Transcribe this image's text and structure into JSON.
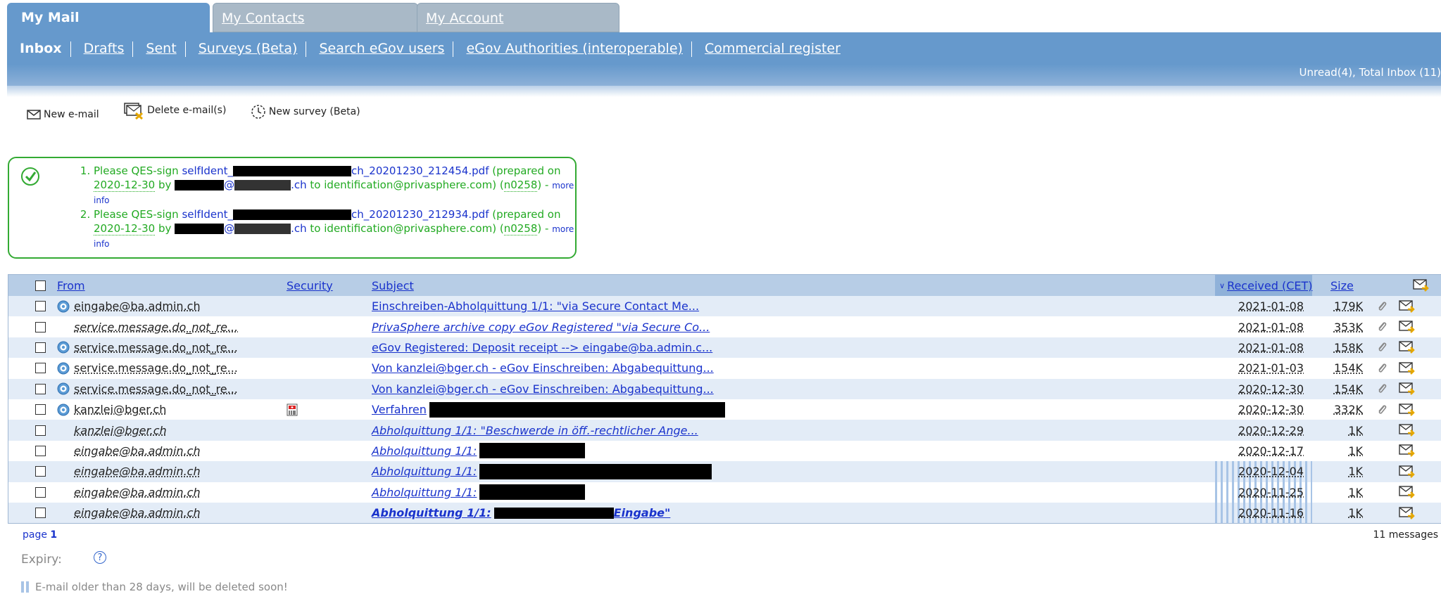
{
  "tabs": [
    {
      "label": "My Mail",
      "active": true
    },
    {
      "label": "My Contacts",
      "active": false
    },
    {
      "label": "My Account",
      "active": false
    }
  ],
  "subnav": {
    "items": [
      "Inbox",
      "Drafts",
      "Sent",
      "Surveys (Beta)",
      "Search eGov users",
      "eGov Authorities (interoperable)",
      "Commercial register"
    ],
    "current": "Inbox",
    "unread_status": "Unread(4), Total Inbox (11)"
  },
  "toolbar": {
    "new_email": "New e-mail",
    "delete_emails": "Delete e-mail(s)",
    "new_survey": "New survey (Beta)"
  },
  "notice": {
    "items": [
      {
        "prefix": "Please QES-sign ",
        "link_start": "selfIdent_",
        "link_end": "ch_20201230_212454.pdf",
        "prepared": " (prepared on ",
        "date": "2020-12-30",
        "by": " by ",
        "email_suffix": ".ch",
        "to": " to identification@privasphere.com) (",
        "code": "n0258",
        "after_code": ") - ",
        "more_info": "more info"
      },
      {
        "prefix": "Please QES-sign ",
        "link_start": "selfIdent_",
        "link_end": "ch_20201230_212934.pdf",
        "prepared": " (prepared on ",
        "date": "2020-12-30",
        "by": " by ",
        "email_suffix": ".ch",
        "to": " to identification@privasphere.com) (",
        "code": "n0258",
        "after_code": ") - ",
        "more_info": "more info"
      }
    ]
  },
  "table": {
    "headers": {
      "from": "From",
      "security": "Security",
      "subject": "Subject",
      "received": "Received (CET)",
      "size": "Size"
    },
    "rows": [
      {
        "from": "eingabe@ba.admin.ch",
        "subject": "Einschreiben-Abholquittung 1/1: \"via Secure Contact Me...",
        "date": "2021-01-08",
        "size": "179K",
        "secure_icon": true,
        "attachment": true,
        "italic": false
      },
      {
        "from": "service.message.do_not_re...",
        "subject": "PrivaSphere archive copy eGov Registered \"via Secure Co...",
        "date": "2021-01-08",
        "size": "353K",
        "secure_icon": false,
        "attachment": true,
        "italic": true
      },
      {
        "from": "service.message.do_not_re...",
        "subject": "eGov Registered: Deposit receipt --> eingabe@ba.admin.c...",
        "date": "2021-01-08",
        "size": "158K",
        "secure_icon": true,
        "attachment": true,
        "italic": false
      },
      {
        "from": "service.message.do_not_re...",
        "subject": "Von kanzlei@bger.ch - eGov Einschreiben: Abgabequittung...",
        "date": "2021-01-03",
        "size": "154K",
        "secure_icon": true,
        "attachment": true,
        "italic": false
      },
      {
        "from": "service.message.do_not_re...",
        "subject": "Von kanzlei@bger.ch - eGov Einschreiben: Abgabequittung...",
        "date": "2020-12-30",
        "size": "154K",
        "secure_icon": true,
        "attachment": true,
        "italic": false
      },
      {
        "from": "kanzlei@bger.ch",
        "subject": "Verfahren",
        "date": "2020-12-30",
        "size": "332K",
        "secure_icon": true,
        "attachment": true,
        "italic": false
      },
      {
        "from": "kanzlei@bger.ch",
        "subject": "Abholquittung 1/1: \"Beschwerde in öff.-rechtlicher Ange...",
        "date": "2020-12-29",
        "size": "1K",
        "secure_icon": false,
        "attachment": false,
        "italic": true
      },
      {
        "from": "eingabe@ba.admin.ch",
        "subject": "Abholquittung 1/1:",
        "date": "2020-12-17",
        "size": "1K",
        "secure_icon": false,
        "attachment": false,
        "italic": true
      },
      {
        "from": "eingabe@ba.admin.ch",
        "subject": "Abholquittung 1/1:",
        "date": "2020-12-04",
        "size": "1K",
        "secure_icon": false,
        "attachment": false,
        "italic": true
      },
      {
        "from": "eingabe@ba.admin.ch",
        "subject": "Abholquittung 1/1:",
        "date": "2020-11-25",
        "size": "1K",
        "secure_icon": false,
        "attachment": false,
        "italic": true
      },
      {
        "from": "eingabe@ba.admin.ch",
        "subject": "Abholquittung 1/1:",
        "subject_tail": "Eingabe\"",
        "date": "2020-11-16",
        "size": "1K",
        "secure_icon": false,
        "attachment": false,
        "italic": true,
        "bold": true
      }
    ]
  },
  "footer": {
    "page_label": "page",
    "page_number": "1",
    "message_count": "11 messages",
    "expiry_label": "Expiry:",
    "help": "?",
    "legend": "E-mail older than 28 days, will be deleted soon!"
  }
}
